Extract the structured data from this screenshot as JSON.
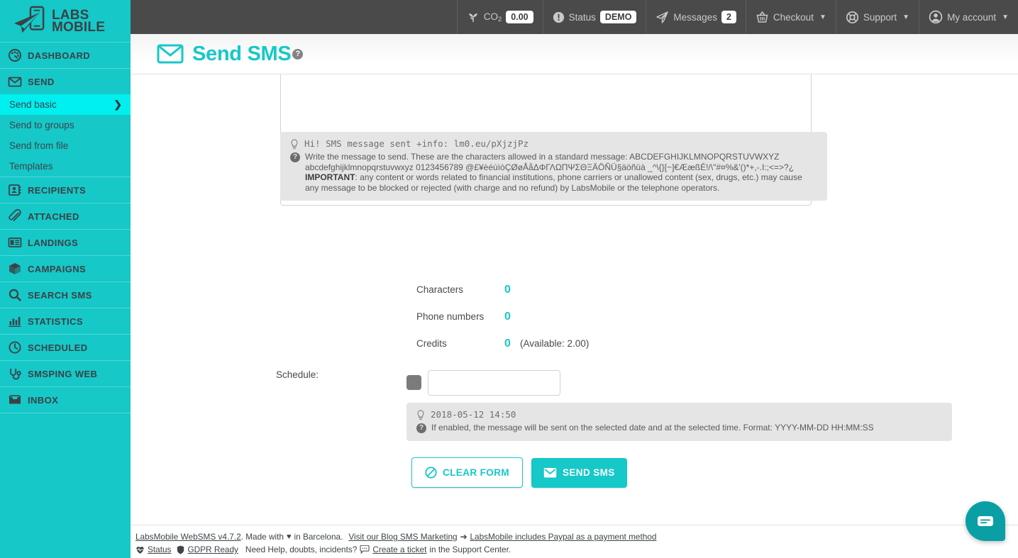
{
  "brand": {
    "name_line1": "LABS",
    "name_line2": "MOBILE",
    "accent": "#16C8C8",
    "accent_bright": "#00EFEF",
    "topbar_bg": "#4a4a4a"
  },
  "sidebar": {
    "items": [
      {
        "label": "DASHBOARD",
        "icon": "dashboard-icon",
        "type": "section"
      },
      {
        "label": "SEND",
        "icon": "envelope-icon",
        "type": "section"
      },
      {
        "label": "Send basic",
        "icon": "chevron-right-icon",
        "type": "sub",
        "active": true
      },
      {
        "label": "Send to groups",
        "type": "sub",
        "active": false
      },
      {
        "label": "Send from file",
        "type": "sub",
        "active": false
      },
      {
        "label": "Templates",
        "type": "sub",
        "active": false
      },
      {
        "label": "RECIPIENTS",
        "icon": "contact-card-icon",
        "type": "section"
      },
      {
        "label": "ATTACHED",
        "icon": "paperclip-icon",
        "type": "section"
      },
      {
        "label": "LANDINGS",
        "icon": "newspaper-icon",
        "type": "section"
      },
      {
        "label": "CAMPAIGNS",
        "icon": "box-icon",
        "type": "section"
      },
      {
        "label": "SEARCH SMS",
        "icon": "search-icon",
        "type": "section"
      },
      {
        "label": "STATISTICS",
        "icon": "bar-chart-icon",
        "type": "section"
      },
      {
        "label": "SCHEDULED",
        "icon": "clock-icon",
        "type": "section"
      },
      {
        "label": "SMSPING WEB",
        "icon": "stethoscope-icon",
        "type": "section"
      },
      {
        "label": "INBOX",
        "icon": "inbox-icon",
        "type": "section"
      }
    ]
  },
  "topbar": {
    "co2": {
      "label": "CO",
      "subscript": "2",
      "value": "0.00",
      "icon": "plant-icon"
    },
    "status": {
      "label": "Status",
      "value": "DEMO",
      "icon": "alert-circle-icon"
    },
    "messages": {
      "label": "Messages",
      "value": "2",
      "icon": "paper-plane-icon"
    },
    "checkout": {
      "label": "Checkout",
      "icon": "basket-icon",
      "caret": "⌄"
    },
    "support": {
      "label": "Support",
      "icon": "lifebuoy-icon",
      "caret": "⌄"
    },
    "account": {
      "label": "My account",
      "icon": "user-circle-icon",
      "caret": "⌄"
    }
  },
  "page": {
    "title": "Send SMS",
    "title_icon": "envelope-icon",
    "help_glyph": "?"
  },
  "message": {
    "textarea_value": "",
    "textarea_placeholder": ""
  },
  "message_info": {
    "hint": "Hi! SMS message sent +info: lm0.eu/pXjzjPz",
    "help_prefix": "Write the message to send. These are the characters allowed in a standard message: ABCDEFGHIJKLMNOPQRSTUVWXYZ abcdefghijklmnopqrstuvwxyz 0123456789 @£¥èéùìòÇØøÅåΔΦΓΛΩΠΨΣΘΞÄÖÑÜ§äöñüà _^\\{}[~]€ÆæßÉ!/\\\"#¤%&'()*+,-.I:;<=>?¿",
    "important_label": "IMPORTANT",
    "important_text": ": any content or words related to financial institutions, phone carriers or unallowed content (sex, drugs, etc.) may cause any message to be blocked or rejected (with charge and no refund) by LabsMobile or the telephone operators."
  },
  "stats": [
    {
      "label": "Characters",
      "value": "0",
      "extra": ""
    },
    {
      "label": "Phone numbers",
      "value": "0",
      "extra": ""
    },
    {
      "label": "Credits",
      "value": "0",
      "extra": "(Available: 2.00)"
    }
  ],
  "schedule": {
    "label": "Schedule:",
    "checkbox_checked": false,
    "input_value": "",
    "input_placeholder": "",
    "hint_example": "2018-05-12 14:50",
    "hint_help": "If enabled, the message will be sent on the selected date and at the selected time. Format: YYYY-MM-DD HH:MM:SS"
  },
  "actions": {
    "clear_label": "CLEAR FORM",
    "clear_icon": "ban-icon",
    "send_label": "SEND SMS",
    "send_icon": "envelope-icon"
  },
  "footer": {
    "line1": {
      "app_link": "LabsMobile WebSMS v4.7.2",
      "made_with": ". Made with",
      "heart": "♥",
      "in_barcelona": "in Barcelona.",
      "blog_link": "Visit our Blog SMS Marketing",
      "arrow": "➔",
      "paypal_link": "LabsMobile includes Paypal as a payment method"
    },
    "line2": {
      "status_link": "Status",
      "status_icon": "heart-pulse-icon",
      "gdpr_link": "GDPR Ready",
      "gdpr_icon": "shield-icon",
      "need_help": "Need Help, doubts, incidents?",
      "ticket_icon": "chat-bubble-icon",
      "ticket_link": "Create a ticket",
      "support_center": "in the Support Center."
    }
  },
  "chat_widget": {
    "icon": "chat-widget-icon",
    "color": "#0a9fa4"
  }
}
